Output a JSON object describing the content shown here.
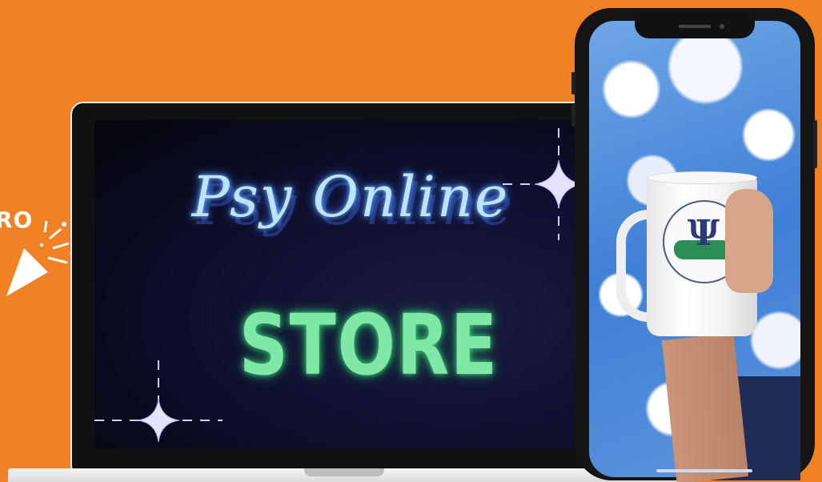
{
  "badge": {
    "text": "RO"
  },
  "laptop": {
    "title_script": "Psy Online",
    "title_main": "STORE"
  },
  "colors": {
    "background": "#F08124",
    "neon_blue": "#bfe3ff",
    "neon_green": "#7fe8a6",
    "laptop_bezel": "#111111",
    "phone_body": "#151515",
    "sky": "#4a86d8"
  },
  "icons": [
    "party-popper-icon",
    "sparkle-icon",
    "psi-logo-icon"
  ]
}
